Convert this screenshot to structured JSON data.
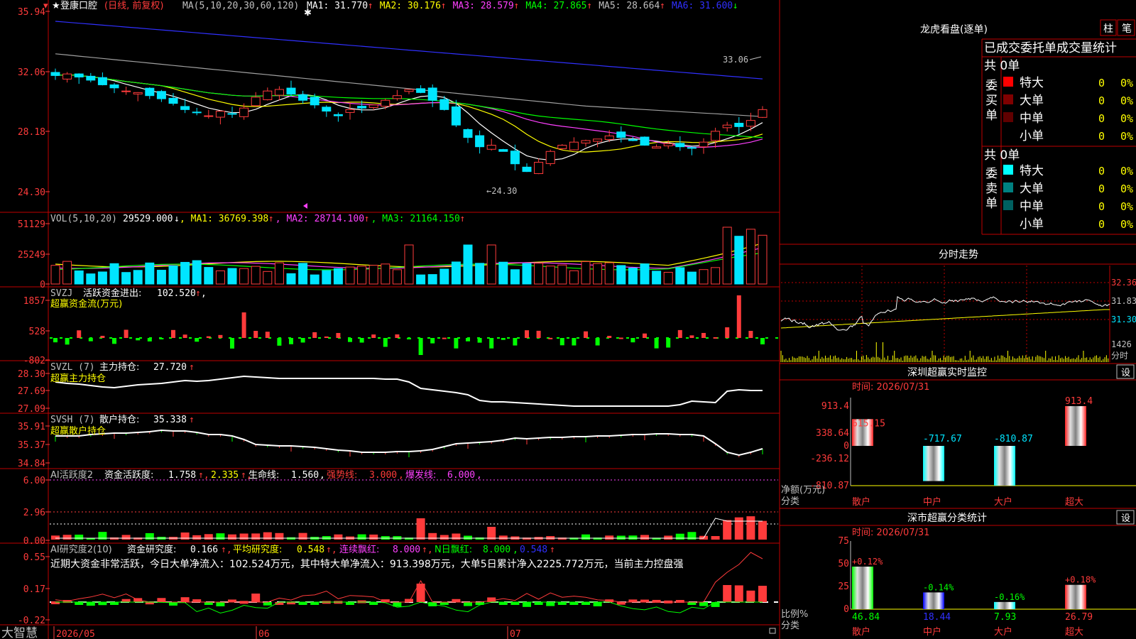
{
  "colors": {
    "up": "#ff3b3b",
    "down": "#00e5ff",
    "grid": "#c00000",
    "white": "#ffffff",
    "yellow": "#ffff00",
    "magenta": "#ff40ff",
    "green": "#00ff00",
    "blue": "#3030ff",
    "gray": "#a0a0a0"
  },
  "main": {
    "title": "登康口腔",
    "mode": "(日线, 前复权)",
    "ma_params": "MA(5,10,20,30,60,120)",
    "ma": [
      {
        "label": "MA1:",
        "value": "31.770",
        "arrow": "↑",
        "color": "#ffffff"
      },
      {
        "label": "MA2:",
        "value": "30.176",
        "arrow": "↑",
        "color": "#ffff00"
      },
      {
        "label": "MA3:",
        "value": "28.579",
        "arrow": "↑",
        "color": "#ff40ff"
      },
      {
        "label": "MA4:",
        "value": "27.865",
        "arrow": "↑",
        "color": "#00ff00"
      },
      {
        "label": "MA5:",
        "value": "28.664",
        "arrow": "↑",
        "color": "#c0c0c0"
      },
      {
        "label": "MA6:",
        "value": "31.600",
        "arrow": "↓",
        "color": "#3030ff"
      }
    ],
    "yticks": [
      "35.94",
      "32.06",
      "28.18",
      "24.30"
    ],
    "hi_label": "33.06",
    "lo_label": "←24.30"
  },
  "vol": {
    "header": "VOL(5,10,20)",
    "value": "29529.000",
    "value_arrow": "↓",
    "ma": [
      {
        "label": "MA1:",
        "value": "36769.398",
        "arrow": "↑",
        "color": "#ffff00"
      },
      {
        "label": "MA2:",
        "value": "28714.100",
        "arrow": "↑",
        "color": "#ff40ff"
      },
      {
        "label": "MA3:",
        "value": "21164.150",
        "arrow": "↑",
        "color": "#00ff00"
      }
    ],
    "yticks": [
      "51129",
      "25249",
      "0"
    ]
  },
  "svzj": {
    "header": "SVZJ",
    "label": "活跃资金进出:",
    "value": "102.520",
    "arrow": "↑",
    "sub": "超赢资金流(万元)",
    "yticks": [
      "1857",
      "528",
      "-802"
    ]
  },
  "svzl": {
    "header": "SVZL (7)",
    "label": "主力持仓:",
    "value": "27.720",
    "arrow": "↑",
    "sub": "超赢主力持仓",
    "yticks": [
      "28.30",
      "27.69",
      "27.09"
    ]
  },
  "svsh": {
    "header": "SVSH (7)",
    "label": "散户持仓:",
    "value": "35.338",
    "arrow": "↑",
    "sub": "超赢散户持仓",
    "yticks": [
      "35.91",
      "35.37",
      "34.84"
    ]
  },
  "ai1": {
    "header": "AI活跃度2",
    "l1": "资金活跃度:",
    "v1": "1.758",
    "v2": "2.335",
    "l3": "生命线:",
    "v3": "1.560",
    "l4": "强势线:",
    "v4": "3.000",
    "l5": "爆发线:",
    "v5": "6.000",
    "yticks": [
      "6.00",
      "2.96",
      "0.00"
    ]
  },
  "ai2": {
    "header": "AI研究度2(10)",
    "l1": "资金研究度:",
    "v1": "0.166",
    "l2": "平均研究度:",
    "v2": "0.548",
    "l3": "连续飘红:",
    "v3": "8.000",
    "l4": "N日飘红:",
    "v4": "8.000",
    "v5": "0.548",
    "yticks": [
      "0.55",
      "0.17",
      "-0.22"
    ]
  },
  "note": "近期大资金非常活跃，今日大单净流入：102.524万元，其中特大单净流入：913.398万元，大单5日累计净入2225.772万元，当前主力控盘强",
  "footer": {
    "brand": "大智慧",
    "dates": [
      "2026/05",
      "06",
      "07"
    ]
  },
  "right": {
    "lhkp_title": "龙虎看盘(逐单)",
    "tab1": "柱",
    "tab2": "笔",
    "stats_title": "已成交委托单成交量统计",
    "buy": {
      "side": "委买单",
      "total": "共 0单",
      "rows": [
        {
          "name": "特大",
          "qty": "0",
          "pct": "0%"
        },
        {
          "name": "大单",
          "qty": "0",
          "pct": "0%"
        },
        {
          "name": "中单",
          "qty": "0",
          "pct": "0%"
        },
        {
          "name": "小单",
          "qty": "0",
          "pct": "0%"
        }
      ]
    },
    "sell": {
      "side": "委卖单",
      "total": "共 0单",
      "rows": [
        {
          "name": "特大",
          "qty": "0",
          "pct": "0%"
        },
        {
          "name": "大单",
          "qty": "0",
          "pct": "0%"
        },
        {
          "name": "中单",
          "qty": "0",
          "pct": "0%"
        },
        {
          "name": "小单",
          "qty": "0",
          "pct": "0%"
        }
      ]
    },
    "intraday": {
      "title": "分时走势",
      "p1": "32.36",
      "p2": "31.83",
      "p3": "31.30",
      "vol": "1426",
      "vol_unit": "分时"
    },
    "monitor": {
      "title": "深圳超赢实时监控",
      "setting": "设",
      "time": "时间: 2026/07/31",
      "yticks": [
        "913.4",
        "338.64",
        "0",
        "-236.12",
        "-810.87"
      ],
      "ylabel": "净额(万元)",
      "xlabel": "分类",
      "bars": [
        {
          "cat": "散户",
          "value": 615.15,
          "label": "615.15"
        },
        {
          "cat": "中户",
          "value": -717.67,
          "label": "-717.67"
        },
        {
          "cat": "大户",
          "value": -810.87,
          "label": "-810.87"
        },
        {
          "cat": "超大",
          "value": 913.4,
          "label": "913.4"
        }
      ]
    },
    "classify": {
      "title": "深市超赢分类统计",
      "setting": "设",
      "time": "时间: 2026/07/31",
      "yticks": [
        "75",
        "50",
        "25",
        "0"
      ],
      "ylabel": "比例%",
      "xlabel": "分类",
      "bars": [
        {
          "cat": "散户",
          "value": 46.84,
          "label": "46.84",
          "chg": "+0.12%"
        },
        {
          "cat": "中户",
          "value": 18.44,
          "label": "18.44",
          "chg": "-0.14%"
        },
        {
          "cat": "大户",
          "value": 7.93,
          "label": "7.93",
          "chg": "-0.16%"
        },
        {
          "cat": "超大",
          "value": 26.79,
          "label": "26.79",
          "chg": "+0.18%"
        }
      ]
    }
  }
}
